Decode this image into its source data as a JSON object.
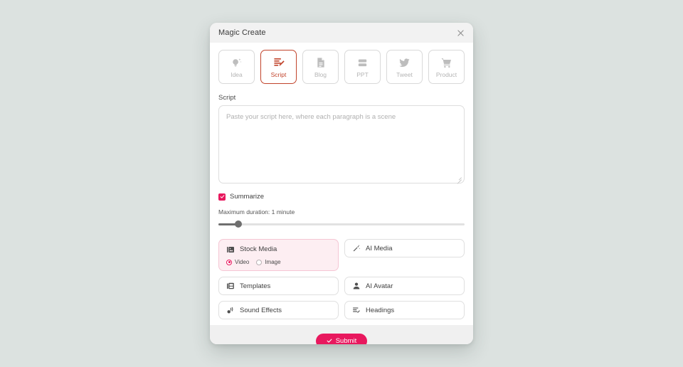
{
  "theme": {
    "page_background": "#dce2e0",
    "accent_pink": "#e8185e",
    "active_tab_color": "#c1432b",
    "card_highlight_background": "#fdeef2",
    "header_background": "#f2f2f2",
    "footer_background": "#f0f0f0"
  },
  "modal": {
    "title": "Magic Create",
    "close_label": "×"
  },
  "tabs": [
    {
      "label": "Idea",
      "icon": "lightbulb-sparkle-icon",
      "active": false
    },
    {
      "label": "Script",
      "icon": "script-pencil-icon",
      "active": true
    },
    {
      "label": "Blog",
      "icon": "document-icon",
      "active": false
    },
    {
      "label": "PPT",
      "icon": "slides-icon",
      "active": false
    },
    {
      "label": "Tweet",
      "icon": "twitter-bird-icon",
      "active": false
    },
    {
      "label": "Product",
      "icon": "shopping-cart-icon",
      "active": false
    }
  ],
  "script": {
    "label": "Script",
    "value": "",
    "placeholder": "Paste your script here, where each paragraph is a scene"
  },
  "summarize": {
    "label": "Summarize",
    "checked": true
  },
  "duration": {
    "label": "Maximum duration: 1 minute",
    "value_percent": 8
  },
  "options": {
    "stock_media": {
      "label": "Stock Media",
      "icon": "images-stack-icon",
      "selected": true,
      "radios": [
        {
          "label": "Video",
          "checked": true
        },
        {
          "label": "Image",
          "checked": false
        }
      ]
    },
    "items": [
      {
        "label": "AI Media",
        "icon": "magic-wand-icon"
      },
      {
        "label": "Templates",
        "icon": "templates-stack-icon"
      },
      {
        "label": "AI Avatar",
        "icon": "person-avatar-icon"
      },
      {
        "label": "Sound Effects",
        "icon": "sound-wave-icon"
      },
      {
        "label": "Headings",
        "icon": "heading-lines-icon"
      }
    ]
  },
  "footer": {
    "submit_label": "Submit",
    "submit_icon": "check-icon"
  }
}
